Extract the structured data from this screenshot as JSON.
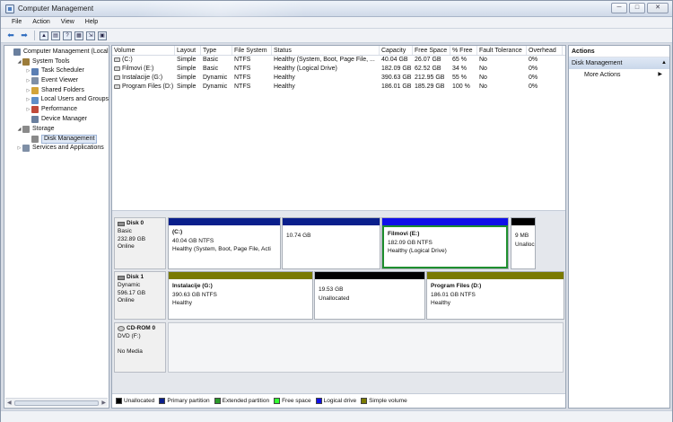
{
  "window": {
    "title": "Computer Management",
    "controls": [
      "─",
      "□",
      "✕"
    ]
  },
  "menu": [
    "File",
    "Action",
    "View",
    "Help"
  ],
  "tree": [
    {
      "label": "Computer Management (Local",
      "level": 0,
      "expander": "",
      "color": "#6a7f9e"
    },
    {
      "label": "System Tools",
      "level": 1,
      "expander": "◢",
      "color": "#9c7c3a"
    },
    {
      "label": "Task Scheduler",
      "level": 2,
      "expander": "▷",
      "color": "#5b7fb4"
    },
    {
      "label": "Event Viewer",
      "level": 2,
      "expander": "▷",
      "color": "#7f8fa6"
    },
    {
      "label": "Shared Folders",
      "level": 2,
      "expander": "▷",
      "color": "#d3a43a"
    },
    {
      "label": "Local Users and Groups",
      "level": 2,
      "expander": "▷",
      "color": "#5f8fc8"
    },
    {
      "label": "Performance",
      "level": 2,
      "expander": "▷",
      "color": "#c04a3a"
    },
    {
      "label": "Device Manager",
      "level": 2,
      "expander": "",
      "color": "#6a7f9e"
    },
    {
      "label": "Storage",
      "level": 1,
      "expander": "◢",
      "color": "#8a8a8a"
    },
    {
      "label": "Disk Management",
      "level": 2,
      "expander": "",
      "color": "#8a8a8a",
      "selected": true
    },
    {
      "label": "Services and Applications",
      "level": 1,
      "expander": "▷",
      "color": "#7f8fa6"
    }
  ],
  "table": {
    "columns": [
      "Volume",
      "Layout",
      "Type",
      "File System",
      "Status",
      "Capacity",
      "Free Space",
      "% Free",
      "Fault Tolerance",
      "Overhead"
    ],
    "rows": [
      [
        "(C:)",
        "Simple",
        "Basic",
        "NTFS",
        "Healthy (System, Boot, Page File, ...",
        "40.04 GB",
        "26.07 GB",
        "65 %",
        "No",
        "0%"
      ],
      [
        "Filmovi (E:)",
        "Simple",
        "Basic",
        "NTFS",
        "Healthy (Logical Drive)",
        "182.09 GB",
        "62.52 GB",
        "34 %",
        "No",
        "0%"
      ],
      [
        "Instalacije (G:)",
        "Simple",
        "Dynamic",
        "NTFS",
        "Healthy",
        "390.63 GB",
        "212.95 GB",
        "55 %",
        "No",
        "0%"
      ],
      [
        "Program Files (D:)",
        "Simple",
        "Dynamic",
        "NTFS",
        "Healthy",
        "186.01 GB",
        "185.29 GB",
        "100 %",
        "No",
        "0%"
      ]
    ]
  },
  "disks": [
    {
      "name": "Disk 0",
      "lines": [
        "Basic",
        "232.89 GB",
        "Online"
      ],
      "icon": "hard-disk-icon",
      "partitions": [
        {
          "name": "(C:)",
          "lines": [
            "40.04 GB NTFS",
            "Healthy (System, Boot, Page File, Acti"
          ],
          "bar": "#0a1f8c"
        },
        {
          "name": "",
          "lines": [
            "10.74 GB"
          ],
          "bar": "#0a1f8c"
        },
        {
          "name": "Filmovi  (E:)",
          "lines": [
            "182.09 GB NTFS",
            "Healthy (Logical Drive)"
          ],
          "bar": "#1010e8",
          "selected": true
        },
        {
          "name": "",
          "lines": [
            "9 MB",
            "Unalloc"
          ],
          "bar": "#000000"
        }
      ]
    },
    {
      "name": "Disk 1",
      "lines": [
        "Dynamic",
        "596.17 GB",
        "Online"
      ],
      "icon": "hard-disk-icon",
      "partitions": [
        {
          "name": "Instalacije  (G:)",
          "lines": [
            "390.63 GB NTFS",
            "Healthy"
          ],
          "bar": "#7a7a00"
        },
        {
          "name": "",
          "lines": [
            "19.53 GB",
            "Unallocated"
          ],
          "bar": "#000000"
        },
        {
          "name": "Program Files  (D:)",
          "lines": [
            "186.01 GB NTFS",
            "Healthy"
          ],
          "bar": "#7a7a00"
        }
      ]
    },
    {
      "name": "CD-ROM 0",
      "lines": [
        "DVD (F:)",
        "",
        "No Media"
      ],
      "icon": "cd-rom-icon",
      "partitions": []
    }
  ],
  "legend": [
    {
      "label": "Unallocated",
      "color": "#000000"
    },
    {
      "label": "Primary partition",
      "color": "#0a1f8c"
    },
    {
      "label": "Extended partition",
      "color": "#2a9a2a"
    },
    {
      "label": "Free space",
      "color": "#33ff33"
    },
    {
      "label": "Logical drive",
      "color": "#1010e8"
    },
    {
      "label": "Simple volume",
      "color": "#7a7a00"
    }
  ],
  "actions": {
    "header": "Actions",
    "section": "Disk Management",
    "items": [
      "More Actions"
    ]
  }
}
